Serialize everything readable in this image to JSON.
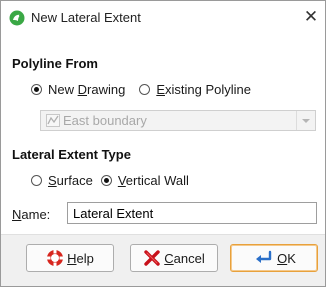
{
  "window": {
    "title": "New Lateral Extent",
    "close_glyph": "✕",
    "app_icon": "leapfrog-icon"
  },
  "polyline_from": {
    "header": "Polyline From",
    "new_drawing_label": "New ",
    "new_drawing_mnemonic": "D",
    "new_drawing_rest": "rawing",
    "existing_mnemonic": "E",
    "existing_rest": "xisting Polyline",
    "selected": "New Drawing",
    "select_value": "East boundary",
    "select_icon": "polyline-icon"
  },
  "lateral_extent_type": {
    "header": "Lateral Extent Type",
    "surface_mnemonic": "S",
    "surface_rest": "urface",
    "vertical_wall_mnemonic": "V",
    "vertical_wall_rest": "ertical Wall",
    "selected": "Vertical Wall"
  },
  "name_field": {
    "label_mnemonic": "N",
    "label_rest": "ame:",
    "value": "Lateral Extent"
  },
  "buttons": {
    "help_mnemonic": "H",
    "help_rest": "elp",
    "cancel_mnemonic": "C",
    "cancel_rest": "ancel",
    "ok_mnemonic": "O",
    "ok_rest": "K"
  },
  "colors": {
    "default_button_border": "#e8a13c",
    "app_icon_green": "#3aa845",
    "help_red": "#d7261e",
    "cancel_red": "#c8101a",
    "ok_blue": "#2a6fc9"
  }
}
